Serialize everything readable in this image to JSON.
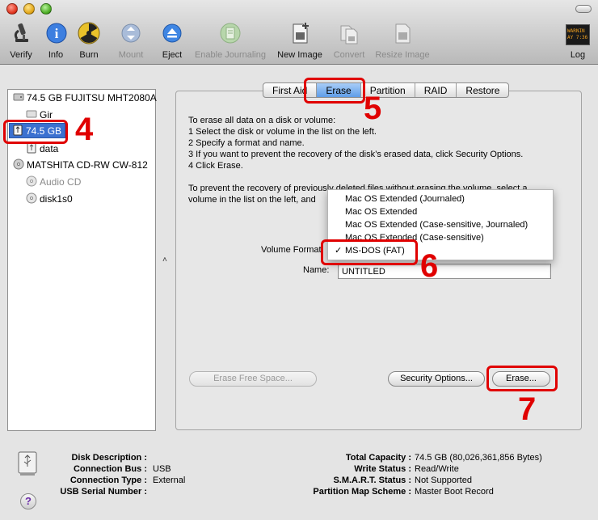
{
  "toolbar": {
    "items": [
      {
        "label": "Verify",
        "icon": "microscope-icon"
      },
      {
        "label": "Info",
        "icon": "info-icon"
      },
      {
        "label": "Burn",
        "icon": "burn-icon"
      },
      {
        "label": "Mount",
        "icon": "mount-icon"
      },
      {
        "label": "Eject",
        "icon": "eject-icon"
      },
      {
        "label": "Enable Journaling",
        "icon": "journaling-icon"
      },
      {
        "label": "New Image",
        "icon": "new-image-icon"
      },
      {
        "label": "Convert",
        "icon": "convert-icon"
      },
      {
        "label": "Resize Image",
        "icon": "resize-image-icon"
      },
      {
        "label": "Log",
        "icon": "log-icon"
      }
    ],
    "log_icon_text": "WARNIN AY 7:36"
  },
  "sidebar": {
    "items": [
      {
        "label": "74.5 GB FUJITSU MHT2080A"
      },
      {
        "label": "Gir"
      },
      {
        "label": "74.5 GB"
      },
      {
        "label": "data"
      },
      {
        "label": "MATSHITA CD-RW CW-812"
      },
      {
        "label": "Audio CD"
      },
      {
        "label": "disk1s0"
      }
    ]
  },
  "tabs": [
    "First Aid",
    "Erase",
    "Partition",
    "RAID",
    "Restore"
  ],
  "active_tab": "Erase",
  "instructions": {
    "line1": "To erase all data on a disk or volume:",
    "line2": "1  Select the disk or volume in the list on the left.",
    "line3": "2  Specify a format and name.",
    "line4": "3  If you want to prevent the recovery of the disk’s erased data, click Security Options.",
    "line5": "4  Click Erase.",
    "line6": "To prevent the recovery of previously deleted files without erasing the volume, select a",
    "line7": "volume in the list on the left, and"
  },
  "volume_format": {
    "label": "Volume Format",
    "options": [
      "Mac OS Extended (Journaled)",
      "Mac OS Extended",
      "Mac OS Extended (Case-sensitive, Journaled)",
      "Mac OS Extended (Case-sensitive)",
      "MS-DOS (FAT)"
    ],
    "selected": "MS-DOS (FAT)",
    "check": "✓"
  },
  "name_field": {
    "label": "Name:",
    "value": "UNTITLED"
  },
  "buttons": {
    "erase_free_space": "Erase Free Space...",
    "security_options": "Security Options...",
    "erase": "Erase..."
  },
  "annotations": {
    "n4": "4",
    "n5": "5",
    "n6": "6",
    "n7": "7"
  },
  "info": {
    "disk_description_label": "Disk Description :",
    "disk_description_value": "",
    "connection_bus_label": "Connection Bus :",
    "connection_bus_value": "USB",
    "connection_type_label": "Connection Type :",
    "connection_type_value": "External",
    "usb_serial_label": "USB Serial Number :",
    "usb_serial_value": "",
    "total_capacity_label": "Total Capacity :",
    "total_capacity_value": "74.5 GB (80,026,361,856 Bytes)",
    "write_status_label": "Write Status :",
    "write_status_value": "Read/Write",
    "smart_status_label": "S.M.A.R.T. Status :",
    "smart_status_value": "Not Supported",
    "partition_map_label": "Partition Map Scheme :",
    "partition_map_value": "Master Boot Record"
  },
  "colors": {
    "annotation_red": "#e00000",
    "selection_blue": "#3b71d0",
    "tab_active": "#5f9de8"
  }
}
